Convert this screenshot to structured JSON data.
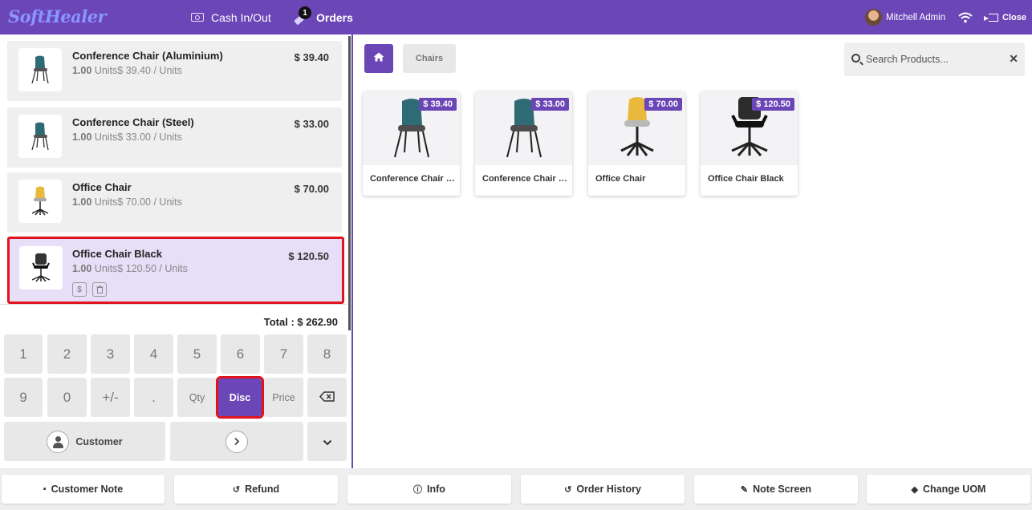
{
  "app": {
    "logo": "SoftHealer",
    "accent": "#6b46b6",
    "highlight": "#e0141e"
  },
  "topbar": {
    "cash_label": "Cash In/Out",
    "orders_label": "Orders",
    "orders_badge": "1",
    "user_name": "Mitchell Admin",
    "close_label": "Close"
  },
  "order": {
    "lines": [
      {
        "name": "Conference Chair (Aluminium)",
        "qty": "1.00",
        "unit_text": "Units$ 39.40 / Units",
        "price": "$ 39.40",
        "image": "conference-chair-icon"
      },
      {
        "name": "Conference Chair (Steel)",
        "qty": "1.00",
        "unit_text": "Units$ 33.00 / Units",
        "price": "$ 33.00",
        "image": "conference-chair-icon"
      },
      {
        "name": "Office Chair",
        "qty": "1.00",
        "unit_text": "Units$ 70.00 / Units",
        "price": "$ 70.00",
        "image": "office-chair-icon"
      },
      {
        "name": "Office Chair Black",
        "qty": "1.00",
        "unit_text": "Units$ 120.50 / Units",
        "price": "$ 120.50",
        "image": "office-chair-black-icon",
        "selected": true
      }
    ],
    "mini_dollar": "$",
    "total": "Total : $ 262.90"
  },
  "keypad": {
    "row1": [
      "1",
      "2",
      "3",
      "4",
      "5",
      "6",
      "7",
      "8"
    ],
    "row2": [
      "9",
      "0",
      "+/-",
      ".",
      "Qty",
      "Disc",
      "Price"
    ],
    "active_key": "Disc",
    "customer_label": "Customer"
  },
  "products": {
    "breadcrumb": "Chairs",
    "search_placeholder": "Search Products...",
    "items": [
      {
        "name": "Conference Chair (Aluminium)",
        "price": "$ 39.40"
      },
      {
        "name": "Conference Chair (Steel)",
        "price": "$ 33.00"
      },
      {
        "name": "Office Chair",
        "price": "$ 70.00"
      },
      {
        "name": "Office Chair Black",
        "price": "$ 120.50"
      }
    ]
  },
  "bottom_bar": {
    "customer_note": "Customer Note",
    "refund": "Refund",
    "info": "Info",
    "order_history": "Order History",
    "note_screen": "Note Screen",
    "change_uom": "Change UOM"
  }
}
